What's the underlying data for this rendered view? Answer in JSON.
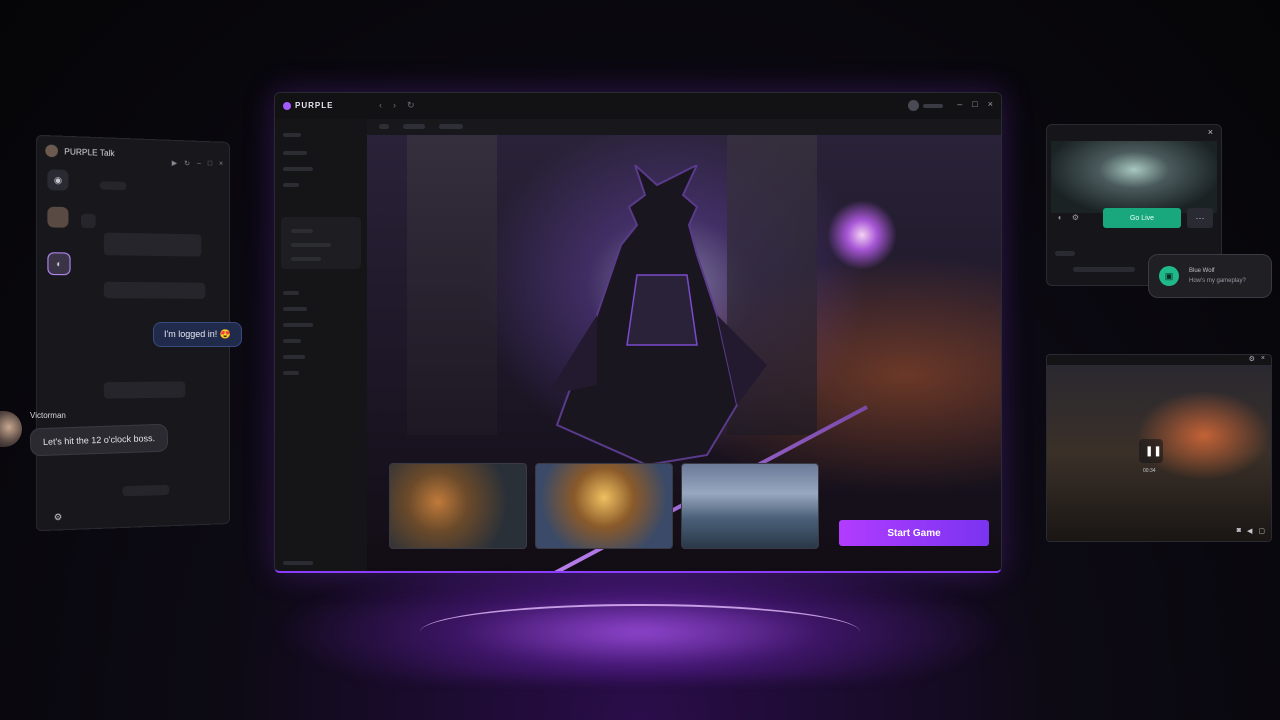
{
  "app": {
    "brand": "PURPLE",
    "window_controls": [
      "–",
      "□",
      "×"
    ],
    "nav": [
      "‹",
      "›",
      "↻"
    ],
    "start_game_label": "Start Game"
  },
  "chat": {
    "title": "PURPLE Talk",
    "controls": [
      "▶",
      "↻",
      "–",
      "□",
      "×"
    ],
    "my_message": "I'm logged in! 😍",
    "incoming": {
      "name": "Victorman",
      "message": "Let's hit the 12 o'clock boss."
    }
  },
  "stream": {
    "go_live_label": "Go Live",
    "more_label": "···",
    "close_label": "×"
  },
  "notification": {
    "sender": "Blue Wolf",
    "message": "How's my gameplay?"
  },
  "video": {
    "pause_label": "❚❚",
    "sublabel": "00:34"
  }
}
